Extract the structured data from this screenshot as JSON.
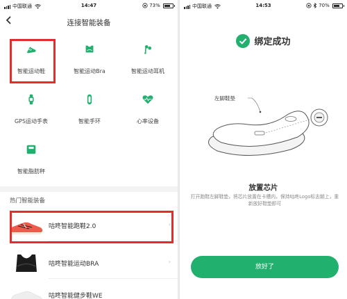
{
  "left_screen": {
    "status": {
      "carrier": "中国联通",
      "time": "14:47",
      "battery": "73%",
      "battery_level": 0.73
    },
    "nav": {
      "back_icon": "chevron-left",
      "title": "连接智能装备"
    },
    "devices": [
      {
        "label": "智能运动鞋",
        "icon": "sneaker-icon",
        "highlighted": true
      },
      {
        "label": "智能运动Bra",
        "icon": "sports-bra-icon",
        "highlighted": false
      },
      {
        "label": "智能运动耳机",
        "icon": "earbuds-icon",
        "highlighted": false
      },
      {
        "label": "GPS运动手表",
        "icon": "watch-icon",
        "highlighted": false
      },
      {
        "label": "智能手环",
        "icon": "band-icon",
        "highlighted": false
      },
      {
        "label": "心率设备",
        "icon": "heart-rate-icon",
        "highlighted": false
      },
      {
        "label": "智能脂肪秤",
        "icon": "scale-icon",
        "highlighted": false
      }
    ],
    "section_title": "热门智能装备",
    "products": [
      {
        "name": "咕咚智能跑鞋2.0",
        "image": "running-shoe-image",
        "highlighted": true
      },
      {
        "name": "咕咚智能运动BRA",
        "image": "sports-bra-image",
        "highlighted": false
      },
      {
        "name": "咕咚智能健步鞋WE",
        "image": "walking-shoe-image",
        "highlighted": false
      }
    ],
    "chevron": "›"
  },
  "right_screen": {
    "status": {
      "carrier": "中国联通",
      "time": "14:53",
      "battery": "70%",
      "battery_level": 0.7
    },
    "bind_title": "绑定成功",
    "insole_label": "左脚鞋垫",
    "chip_title": "放置芯片",
    "chip_desc": "打开跑鞋左脚鞋垫，将芯片放置在卡槽内，保持咕咚Logo标志朝上，重新放好鞋垫即可",
    "button_label": "放好了"
  },
  "colors": {
    "brand_green": "#21b06e",
    "highlight_red": "#e32d2d"
  }
}
